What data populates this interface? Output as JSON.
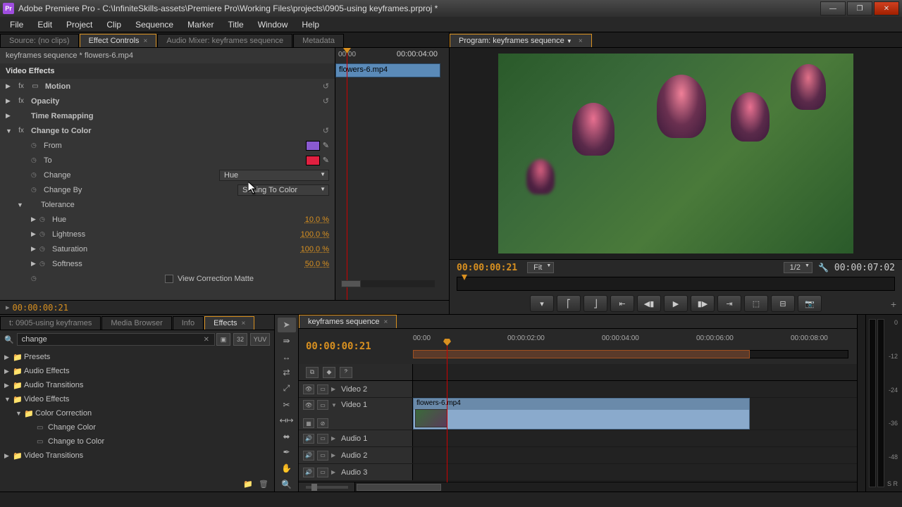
{
  "app": {
    "title": "Adobe Premiere Pro - C:\\InfiniteSkills-assets\\Premiere Pro\\Working Files\\projects\\0905-using keyframes.prproj *",
    "icon": "Pr"
  },
  "menu": [
    "File",
    "Edit",
    "Project",
    "Clip",
    "Sequence",
    "Marker",
    "Title",
    "Window",
    "Help"
  ],
  "source_tabs": {
    "source": "Source: (no clips)",
    "effect_controls": "Effect Controls",
    "audio_mixer": "Audio Mixer: keyframes sequence",
    "metadata": "Metadata"
  },
  "effect_controls": {
    "header": "keyframes sequence * flowers-6.mp4",
    "section": "Video Effects",
    "motion": "Motion",
    "opacity": "Opacity",
    "time_remapping": "Time Remapping",
    "change_to_color": "Change to Color",
    "from": {
      "label": "From",
      "color": "#8a5ad0"
    },
    "to": {
      "label": "To",
      "color": "#e02040"
    },
    "change": {
      "label": "Change",
      "value": "Hue"
    },
    "change_by": {
      "label": "Change By",
      "value": "Setting To Color"
    },
    "tolerance": "Tolerance",
    "hue": {
      "label": "Hue",
      "value": "10.0 %"
    },
    "lightness": {
      "label": "Lightness",
      "value": "100.0 %"
    },
    "saturation": {
      "label": "Saturation",
      "value": "100.0 %"
    },
    "softness": {
      "label": "Softness",
      "value": "50.0 %"
    },
    "view_correction": "View Correction Matte",
    "tl_time": "00:00:04:00",
    "tl_time_0": "00:00",
    "tl_clip": "flowers-6.mp4",
    "footer_time": "00:00:00:21"
  },
  "program": {
    "tab": "Program: keyframes sequence",
    "time_left": "00:00:00:21",
    "fit": "Fit",
    "zoom": "1/2",
    "time_right": "00:00:07:02"
  },
  "project": {
    "tabs": {
      "project": "t: 0905-using keyframes",
      "media": "Media Browser",
      "info": "Info",
      "effects": "Effects"
    },
    "search": "change",
    "sq_btn": "32",
    "yuv_btn": "YUV",
    "tree": {
      "presets": "Presets",
      "audio_effects": "Audio Effects",
      "audio_transitions": "Audio Transitions",
      "video_effects": "Video Effects",
      "color_correction": "Color Correction",
      "change_color": "Change Color",
      "change_to_color": "Change to Color",
      "video_transitions": "Video Transitions"
    }
  },
  "timeline": {
    "tab": "keyframes sequence",
    "time": "00:00:00:21",
    "ticks": [
      "00:00",
      "00:00:02:00",
      "00:00:04:00",
      "00:00:06:00",
      "00:00:08:00"
    ],
    "tracks": {
      "v2": "Video 2",
      "v1": "Video 1",
      "a1": "Audio 1",
      "a2": "Audio 2",
      "a3": "Audio 3"
    },
    "clip": "flowers-6.mp4"
  },
  "meters": {
    "ticks": [
      "0",
      "-12",
      "-24",
      "-36",
      "-48",
      "S  R"
    ]
  }
}
